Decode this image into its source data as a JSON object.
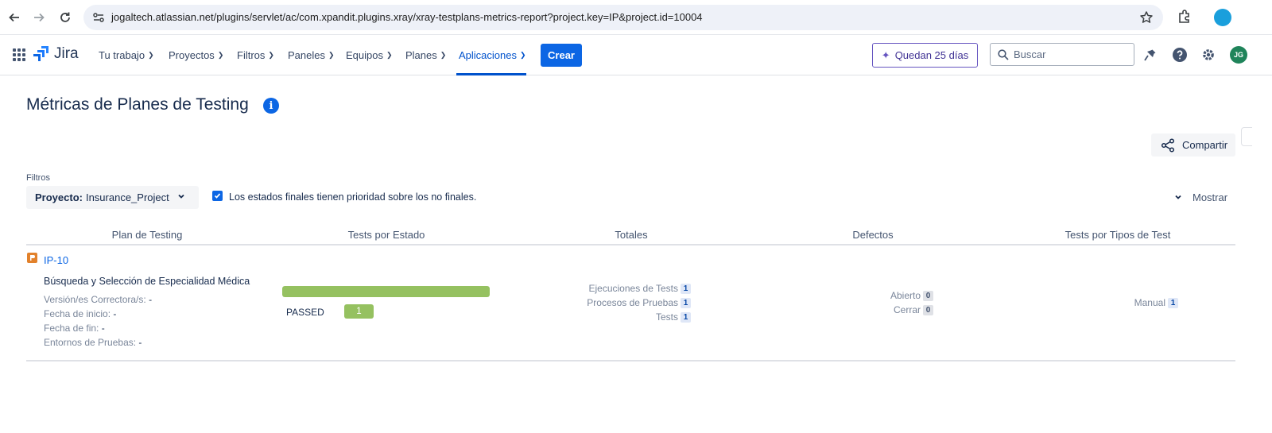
{
  "browser": {
    "url": "jogaltech.atlassian.net/plugins/servlet/ac/com.xpandit.plugins.xray/xray-testplans-metrics-report?project.key=IP&project.id=10004"
  },
  "nav": {
    "logo": "Jira",
    "items": [
      {
        "label": "Tu trabajo"
      },
      {
        "label": "Proyectos"
      },
      {
        "label": "Filtros"
      },
      {
        "label": "Paneles"
      },
      {
        "label": "Equipos"
      },
      {
        "label": "Planes"
      },
      {
        "label": "Aplicaciones",
        "active": true
      }
    ],
    "create_label": "Crear",
    "trial_label": "Quedan 25 días",
    "search_placeholder": "Buscar",
    "avatar_initials": "JG"
  },
  "page": {
    "title": "Métricas de Planes de Testing",
    "share_label": "Compartir",
    "filters_label": "Filtros",
    "project_filter_key": "Proyecto:",
    "project_filter_value": "Insurance_Project",
    "checkbox_label": "Los estados finales tienen prioridad sobre los no finales.",
    "checkbox_checked": true,
    "show_label": "Mostrar"
  },
  "table": {
    "headers": [
      "Plan de Testing",
      "Tests por Estado",
      "Totales",
      "Defectos",
      "Tests por Tipos de Test"
    ],
    "rows": [
      {
        "key": "IP-10",
        "summary": "Búsqueda y Selección de Especialidad Médica",
        "meta": [
          {
            "label": "Versión/es Correctora/s:",
            "value": "-"
          },
          {
            "label": "Fecha de inicio:",
            "value": "-"
          },
          {
            "label": "Fecha de fin:",
            "value": "-"
          },
          {
            "label": "Entornos de Pruebas:",
            "value": "-"
          }
        ],
        "status": {
          "label": "PASSED",
          "count": "1",
          "fraction": 1.0,
          "color": "#95c160"
        },
        "totals": [
          {
            "label": "Ejecuciones de Tests",
            "value": "1"
          },
          {
            "label": "Procesos de Pruebas",
            "value": "1"
          },
          {
            "label": "Tests",
            "value": "1"
          }
        ],
        "defects": [
          {
            "label": "Abierto",
            "value": "0"
          },
          {
            "label": "Cerrar",
            "value": "0"
          }
        ],
        "test_types": [
          {
            "label": "Manual",
            "value": "1"
          }
        ]
      }
    ]
  },
  "colors": {
    "accent": "#0c66e4",
    "passed": "#95c160",
    "plan_icon": "#e2812b"
  }
}
